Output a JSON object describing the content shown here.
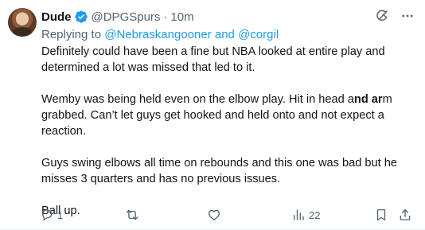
{
  "author": {
    "name": "Dude",
    "handle": "@DPGSpurs",
    "separator": "·",
    "time": "10m",
    "verified": true,
    "verified_color": "#1d9bf0"
  },
  "replying": {
    "prefix": "Replying to",
    "mention1": "@Nebraskangooner",
    "conjunction": "and",
    "mention2": "@corgil"
  },
  "body": {
    "p1_line1": "Definitely could have been a fine but NBA looked at entire play and",
    "p1_line2": "determined a lot was missed that led to it.",
    "p2_line1_a": "Wemby was being held even on the elbow play. Hit in head a",
    "p2_line1_b": "nd ar",
    "p2_line1_c": "m",
    "p2_line2": "grabbed. Can’t let guys get hooked and held onto and not expect a",
    "p2_line3": "reaction.",
    "p3_line1": "Guys swing elbows all time on rebounds and this one was bad but he",
    "p3_line2": "misses 3 quarters and has no previous issues.",
    "p4_line1": "Ball up."
  },
  "top_icons": [
    "grok-icon",
    "more-icon"
  ],
  "actions": {
    "reply_count": "1",
    "retweet_count": "",
    "like_count": "",
    "views_count": "22"
  },
  "colors": {
    "text": "#0f1419",
    "secondary": "#536471",
    "link": "#1d9bf0"
  }
}
